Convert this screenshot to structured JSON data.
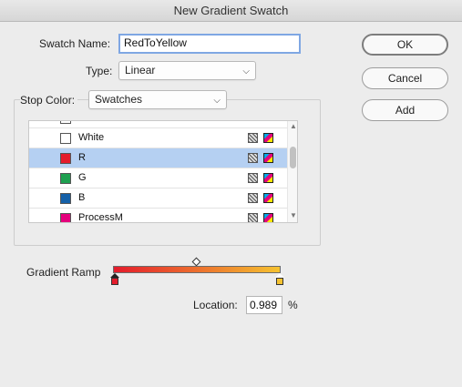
{
  "window": {
    "title": "New Gradient Swatch"
  },
  "form": {
    "swatch_name_label": "Swatch Name:",
    "swatch_name_value": "RedToYellow",
    "type_label": "Type:",
    "type_value": "Linear",
    "stop_color_label": "Stop Color:",
    "stop_color_value": "Swatches"
  },
  "buttons": {
    "ok": "OK",
    "cancel": "Cancel",
    "add": "Add"
  },
  "swatches": [
    {
      "name": "White",
      "color": "#ffffff",
      "selected": false
    },
    {
      "name": "R",
      "color": "#e41c2c",
      "selected": true
    },
    {
      "name": "G",
      "color": "#1ea050",
      "selected": false
    },
    {
      "name": "B",
      "color": "#1460a8",
      "selected": false
    },
    {
      "name": "ProcessM",
      "color": "#e4007c",
      "selected": false
    }
  ],
  "ramp": {
    "label": "Gradient Ramp",
    "start_color": "#e41c2c",
    "end_color": "#f5c230",
    "location_label": "Location:",
    "location_value": "0.989",
    "location_unit": "%"
  },
  "icons": {
    "type_chevron": "chevron-down-icon",
    "stop_chevron": "chevron-down-icon",
    "scroll_up": "scroll-up-arrow-icon",
    "scroll_down": "scroll-down-arrow-icon",
    "process_icon": "process-color-icon",
    "cmyk_icon": "cmyk-mode-icon",
    "midpoint": "midpoint-diamond-icon"
  }
}
